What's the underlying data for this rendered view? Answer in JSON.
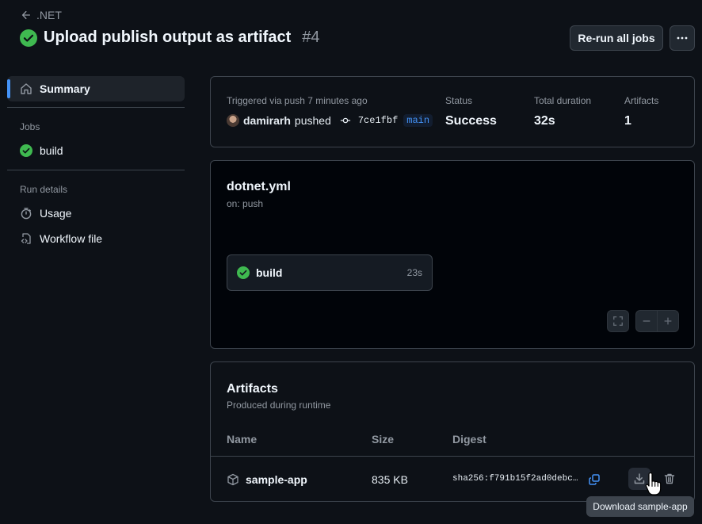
{
  "header": {
    "back_label": ".NET",
    "title": "Upload publish output as artifact",
    "run_number": "#4",
    "rerun_label": "Re-run all jobs"
  },
  "sidebar": {
    "summary_label": "Summary",
    "jobs_heading": "Jobs",
    "jobs": [
      {
        "label": "build",
        "status": "success"
      }
    ],
    "run_details_heading": "Run details",
    "usage_label": "Usage",
    "workflow_file_label": "Workflow file"
  },
  "summary": {
    "trigger_text": "Triggered via push 7 minutes ago",
    "actor": "damirarh",
    "action": "pushed",
    "commit_sha": "7ce1fbf",
    "branch": "main",
    "status_label": "Status",
    "status_value": "Success",
    "duration_label": "Total duration",
    "duration_value": "32s",
    "artifacts_label": "Artifacts",
    "artifacts_value": "1"
  },
  "workflow": {
    "file": "dotnet.yml",
    "trigger": "on: push",
    "job_name": "build",
    "job_duration": "23s"
  },
  "artifacts": {
    "title": "Artifacts",
    "subtitle": "Produced during runtime",
    "columns": {
      "name": "Name",
      "size": "Size",
      "digest": "Digest"
    },
    "rows": [
      {
        "name": "sample-app",
        "size": "835 KB",
        "digest": "sha256:f791b15f2ad0debc…"
      }
    ]
  },
  "tooltip": "Download sample-app",
  "colors": {
    "background": "#0d1117",
    "success": "#3fb950",
    "accent": "#4493f8",
    "border": "#3d444d"
  }
}
